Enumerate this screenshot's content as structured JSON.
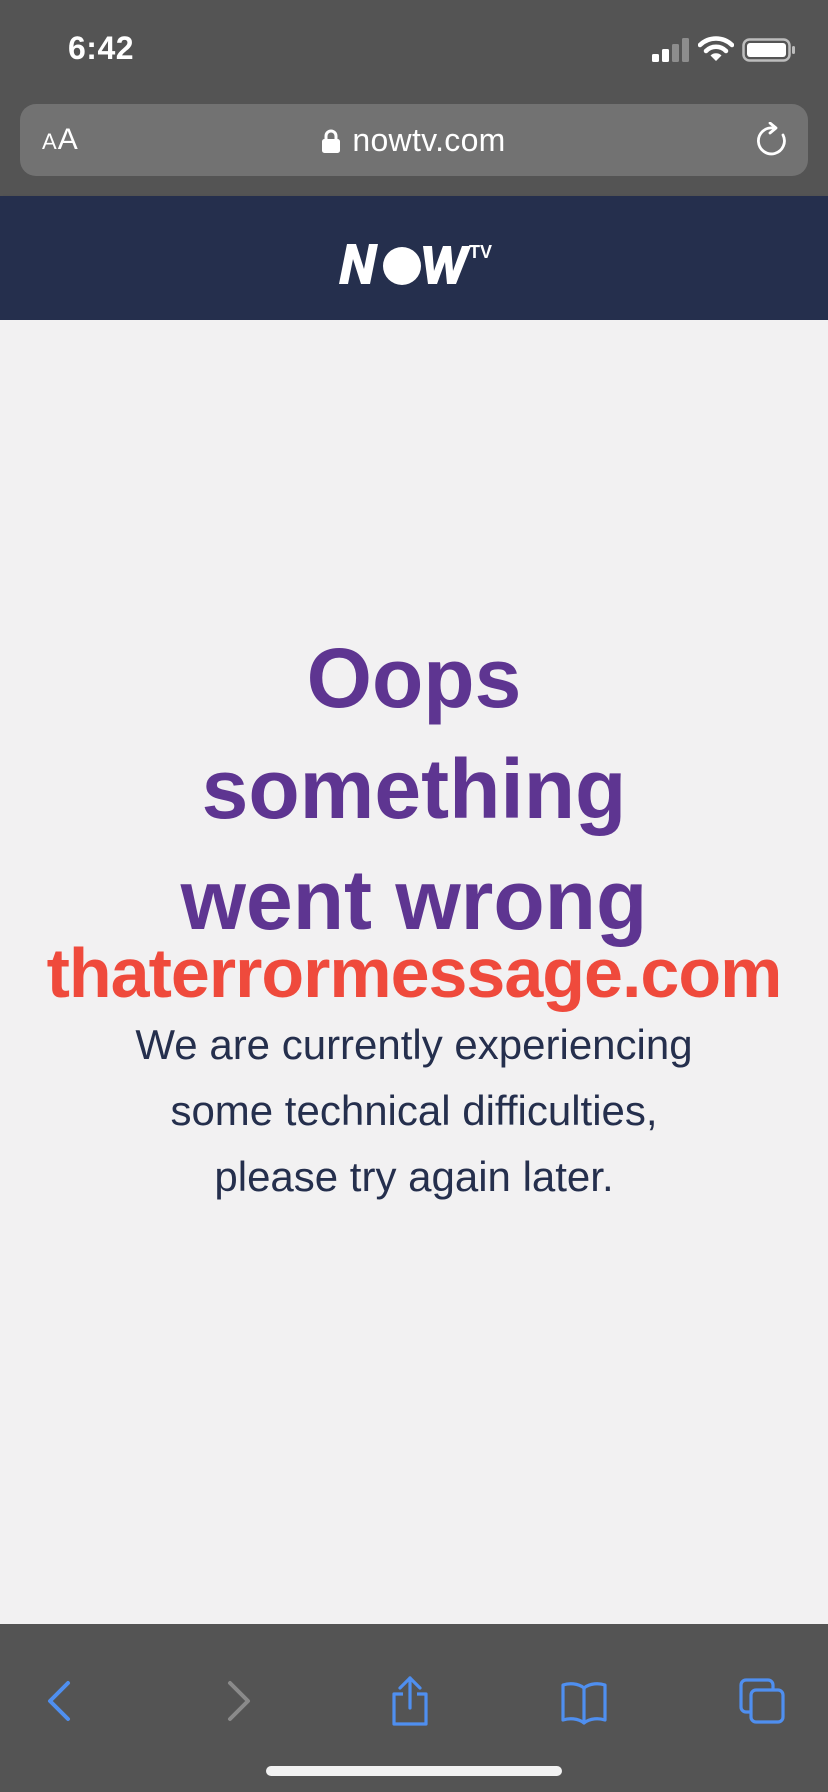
{
  "status_bar": {
    "time": "6:42",
    "signal_icon": "cellular-signal-icon",
    "wifi_icon": "wifi-icon",
    "battery_icon": "battery-icon"
  },
  "browser": {
    "text_size_small": "A",
    "text_size_large": "A",
    "lock_icon": "lock-icon",
    "url": "nowtv.com",
    "reload_icon": "reload-icon"
  },
  "site": {
    "logo_word": "NOW",
    "logo_suffix": "TV",
    "header_color": "#252f4d"
  },
  "error": {
    "headline_line1": "Oops",
    "headline_line2": "something",
    "headline_line3": "went wrong",
    "message_line1": "We are currently experiencing",
    "message_line2": "some technical difficulties,",
    "message_line3": "please try again later.",
    "headline_color": "#5e3591",
    "message_color": "#252f4d"
  },
  "watermark": {
    "text": "thaterrormessage.com",
    "color": "#ef4a3c"
  },
  "toolbar": {
    "back_icon": "back-chevron-icon",
    "forward_icon": "forward-chevron-icon",
    "share_icon": "share-icon",
    "bookmarks_icon": "bookmarks-book-icon",
    "tabs_icon": "tabs-icon",
    "active_color": "#4f8ff0",
    "disabled_color": "#8a8a8a"
  }
}
